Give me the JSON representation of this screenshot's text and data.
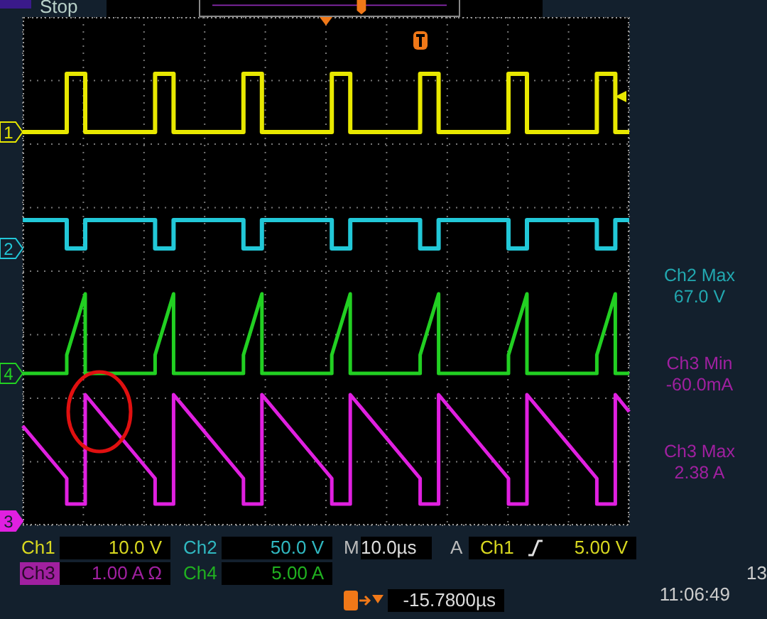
{
  "status": "Stop",
  "channels": [
    {
      "label": "1",
      "color": "#e8e800",
      "selected": false
    },
    {
      "label": "2",
      "color": "#22c8d8",
      "selected": false
    },
    {
      "label": "4",
      "color": "#22d022",
      "selected": false
    },
    {
      "label": "3",
      "color": "#e020e0",
      "selected": true
    }
  ],
  "measurements": [
    {
      "title": "Ch2 Max",
      "value": "67.0 V",
      "color": "#22a8b0"
    },
    {
      "title": "Ch3 Min",
      "value": "-60.0mA",
      "color": "#a020a0"
    },
    {
      "title": "Ch3 Max",
      "value": "2.38 A",
      "color": "#a020a0"
    }
  ],
  "readouts": [
    {
      "label": "Ch1",
      "value": "10.0 V",
      "color": "#d8d820",
      "selected": false
    },
    {
      "label": "Ch2",
      "value": "50.0 V",
      "color": "#30b8c0",
      "selected": false
    },
    {
      "label": "Ch3",
      "value": "1.00 A Ω",
      "color": "#a020a0",
      "selected": true
    },
    {
      "label": "Ch4",
      "value": "5.00 A",
      "color": "#20b020",
      "selected": false
    }
  ],
  "timebase": {
    "label": "M",
    "value": "10.0µs"
  },
  "trigger": {
    "label": "A",
    "source": "Ch1",
    "threshold": "5.00 V"
  },
  "trigger_position": "-15.7800µs",
  "clock": {
    "date": "13",
    "time": "11:06:49"
  }
}
